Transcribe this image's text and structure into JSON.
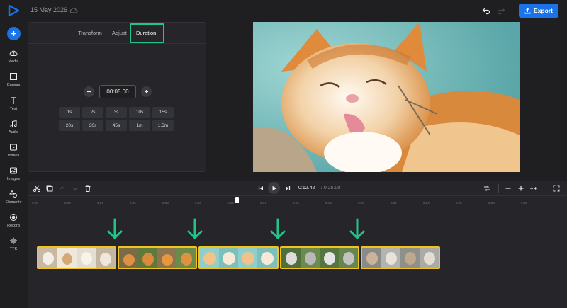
{
  "header": {
    "date": "15 May 2026",
    "export_label": "Export"
  },
  "sidebar": {
    "items": [
      {
        "label": "Media",
        "icon": "cloud-upload-icon"
      },
      {
        "label": "Canvas",
        "icon": "canvas-icon"
      },
      {
        "label": "Text",
        "icon": "text-icon"
      },
      {
        "label": "Audio",
        "icon": "music-note-icon"
      },
      {
        "label": "Videos",
        "icon": "video-icon"
      },
      {
        "label": "Images",
        "icon": "image-icon"
      },
      {
        "label": "Elements",
        "icon": "shapes-icon"
      },
      {
        "label": "Record",
        "icon": "record-icon"
      },
      {
        "label": "TTS",
        "icon": "waveform-icon"
      }
    ]
  },
  "panel": {
    "tabs": [
      {
        "label": "Transform"
      },
      {
        "label": "Adjust"
      },
      {
        "label": "Duration"
      }
    ],
    "active_tab": "Duration",
    "duration_value": "00:05.00",
    "presets": [
      "1s",
      "2s",
      "3s",
      "10s",
      "15s",
      "20s",
      "30s",
      "45s",
      "1m",
      "1.5m"
    ]
  },
  "timeline": {
    "current_time": "0:12.42",
    "total_time": "/ 0:25.00",
    "ruler": [
      "0:00",
      "0:02",
      "0:04",
      "0:06",
      "0:08",
      "0:10",
      "0:12",
      "0:14",
      "0:16",
      "0:18",
      "0:20",
      "0:22",
      "0:24",
      "0:26",
      "0:28",
      "0:30"
    ],
    "clip_count": 5
  },
  "colors": {
    "accent": "#1a73e8",
    "highlight": "#22c48a",
    "clip_border": "#f2c21e"
  }
}
